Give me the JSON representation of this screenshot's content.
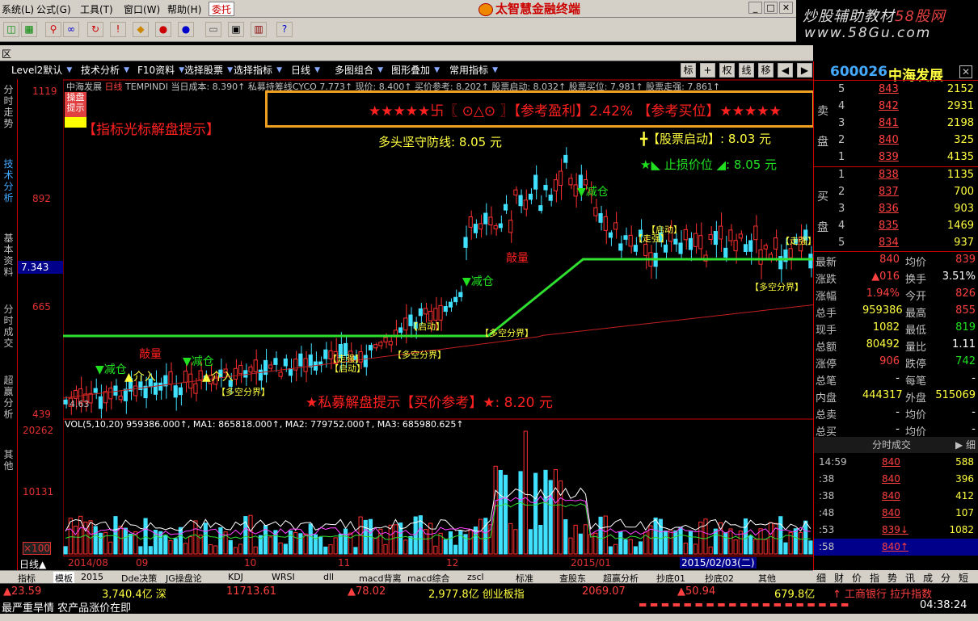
{
  "menu": {
    "items": [
      "系统(L)",
      "公式(G)",
      "工具(T)",
      "窗口(W)",
      "帮助(H)"
    ],
    "entrust": "委托",
    "app_title": "太智慧金融终端"
  },
  "brand": {
    "line1": "炒股辅助教材",
    "line1_url": "58股网",
    "line2": "www.58Gu.com"
  },
  "qu_label": "区",
  "tabs": [
    "Level2默认",
    "技术分析",
    "F10资料",
    "选择股票",
    "选择指标",
    "日线",
    "多图组合",
    "图形叠加",
    "常用指标"
  ],
  "toolbar_right": [
    "标",
    "+",
    "权",
    "线",
    "移",
    "◀",
    "▶"
  ],
  "side_tabs": [
    "分时走势",
    "技术分析",
    "基本资料",
    "分时成交",
    "超赢分析",
    "其他"
  ],
  "y_labels": [
    "1119",
    "892",
    "665",
    "439"
  ],
  "current_price_label": "7.343",
  "vol_labels": [
    "20262",
    "10131",
    "×100"
  ],
  "indicator_line": {
    "stock": "中海发展",
    "period": "日线",
    "text": "TEMPINDI 当日成本: 8.390↑ 私募持筹线CYCO 7.773↑ 现价: 8.400↑ 买价参考: 8.202↑ 股票启动: 8.032↑ 股票买位: 7.981↑ 股票走强: 7.861↑"
  },
  "cursor_hint": "操盘提示",
  "banner": {
    "text": "★★★★★卐〖 ⊙△⊙ 〗【参考盈利】2.42%  【参考买位】★★★★★"
  },
  "chart_labels": {
    "hint_title": "【指标光标解盘提示】",
    "defense": "多头坚守防线: 8.05 元",
    "start": "╋【股票启动】: 8.03 元",
    "stop": "★◣ 止损价位 ◢: 8.05 元",
    "buy_ref": "★私募解盘提示【买价参考】★: 8.20 元",
    "reduce": "▼减仓",
    "qiao_liang": "敲量",
    "price_low": "4.63",
    "jie": "介入",
    "bull_bear": "【多空分界】",
    "start_short": "【启动】",
    "strong": "【走强】"
  },
  "vol_line": "VOL(5,10,20) 959386.000↑, MA1: 865818.000↑, MA2: 779752.000↑, MA3: 685980.625↑",
  "x_labels": [
    "日线▲",
    "2014/08",
    "09",
    "10",
    "11",
    "12",
    "2015/01",
    "2015/02/03(二)"
  ],
  "bottom_tabs": [
    "指标",
    "模板",
    "2015",
    "Dde决策",
    "JG操盘论",
    "KDJ",
    "WRSI",
    "dll",
    "macd背离",
    "macd综合",
    "zscl",
    "标准",
    "查股东",
    "超赢分析",
    "抄底01",
    "抄底02",
    "其他"
  ],
  "right_panel": {
    "code": "600026",
    "name": "中海发展",
    "close_x": "✕",
    "sell_label": "卖盘",
    "buy_label": "买盘",
    "sell": [
      {
        "level": "5",
        "price": "843",
        "vol": "2152"
      },
      {
        "level": "4",
        "price": "842",
        "vol": "2931"
      },
      {
        "level": "3",
        "price": "841",
        "vol": "2198"
      },
      {
        "level": "2",
        "price": "840",
        "vol": "325"
      },
      {
        "level": "1",
        "price": "839",
        "vol": "4135"
      }
    ],
    "buy": [
      {
        "level": "1",
        "price": "838",
        "vol": "1135"
      },
      {
        "level": "2",
        "price": "837",
        "vol": "700"
      },
      {
        "level": "3",
        "price": "836",
        "vol": "903"
      },
      {
        "level": "4",
        "price": "835",
        "vol": "1469"
      },
      {
        "level": "5",
        "price": "834",
        "vol": "937"
      }
    ],
    "stats": [
      {
        "k": "最新",
        "v1": "840",
        "c1": "red",
        "k2": "均价",
        "v2": "839",
        "c2": "red"
      },
      {
        "k": "涨跌",
        "v1": "▲016",
        "c1": "red",
        "k2": "换手",
        "v2": "3.51%",
        "c2": "wht"
      },
      {
        "k": "涨幅",
        "v1": "1.94%",
        "c1": "red",
        "k2": "今开",
        "v2": "826",
        "c2": "red"
      },
      {
        "k": "总手",
        "v1": "959386",
        "c1": "yel",
        "k2": "最高",
        "v2": "855",
        "c2": "red"
      },
      {
        "k": "现手",
        "v1": "1082",
        "c1": "yel",
        "k2": "最低",
        "v2": "819",
        "c2": "grn"
      },
      {
        "k": "总额",
        "v1": "80492",
        "c1": "yel",
        "k2": "量比",
        "v2": "1.11",
        "c2": "wht"
      },
      {
        "k": "涨停",
        "v1": "906",
        "c1": "red",
        "k2": "跌停",
        "v2": "742",
        "c2": "grn"
      },
      {
        "k": "总笔",
        "v1": "-",
        "c1": "wht",
        "k2": "每笔",
        "v2": "-",
        "c2": "wht"
      },
      {
        "k": "内盘",
        "v1": "444317",
        "c1": "yel",
        "k2": "外盘",
        "v2": "515069",
        "c2": "yel"
      },
      {
        "k": "总卖",
        "v1": "-",
        "c1": "wht",
        "k2": "均价",
        "v2": "-",
        "c2": "wht"
      },
      {
        "k": "总买",
        "v1": "-",
        "c1": "wht",
        "k2": "均价",
        "v2": "-",
        "c2": "wht"
      }
    ],
    "tick_title": "分时成交",
    "tick_detail": "▶ 细",
    "ticks": [
      {
        "t": "14:59",
        "p": "840",
        "v": "588",
        "c": "yel",
        "arrow": ""
      },
      {
        "t": ":38",
        "p": "840",
        "v": "396",
        "c": "yel",
        "arrow": ""
      },
      {
        "t": ":38",
        "p": "840",
        "v": "412",
        "c": "yel",
        "arrow": ""
      },
      {
        "t": ":48",
        "p": "840",
        "v": "107",
        "c": "yel",
        "arrow": ""
      },
      {
        "t": ":53",
        "p": "839↓",
        "v": "1082",
        "c": "yel",
        "arrow": "down"
      },
      {
        "t": ":58",
        "p": "840↑",
        "v": "",
        "c": "yel",
        "arrow": "up"
      }
    ],
    "tabs": [
      "细",
      "财",
      "价",
      "指",
      "势",
      "讯",
      "成",
      "分",
      "短"
    ]
  },
  "index_bar1": [
    {
      "text": "▲23.59",
      "c": "red"
    },
    {
      "text": "3,740.4亿 深",
      "c": "yel"
    },
    {
      "text": "11713.61",
      "c": "red"
    },
    {
      "text": "▲78.02",
      "c": "red"
    },
    {
      "text": "2,977.8亿 创业板指",
      "c": "yel"
    },
    {
      "text": "2069.07",
      "c": "red"
    },
    {
      "text": "▲50.94",
      "c": "red"
    },
    {
      "text": "679.8亿",
      "c": "yel"
    },
    {
      "text": "↑ 工商银行 拉升指数",
      "c": "red"
    }
  ],
  "index_bar2": {
    "text": "最严重旱情 农产品涨价在即",
    "clock": "04:38:24"
  }
}
